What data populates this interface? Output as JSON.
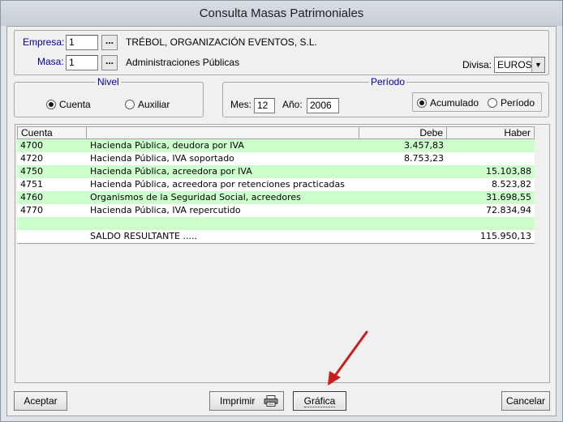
{
  "window": {
    "title": "Consulta Masas Patrimoniales"
  },
  "header": {
    "empresa_label": "Empresa:",
    "empresa_value": "1",
    "empresa_name": "TRÉBOL, ORGANIZACIÓN EVENTOS, S.L.",
    "masa_label": "Masa:",
    "masa_value": "1",
    "masa_name": "Administraciones Públicas",
    "lookup_label": "...",
    "divisa_label": "Divisa:",
    "divisa_value": "EUROS"
  },
  "nivel": {
    "title": "Nivel",
    "options": [
      {
        "label": "Cuenta",
        "selected": true
      },
      {
        "label": "Auxiliar",
        "selected": false
      }
    ]
  },
  "periodo": {
    "title": "Período",
    "mes_label": "Mes:",
    "mes_value": "12",
    "anio_label": "Año:",
    "anio_value": "2006",
    "options": [
      {
        "label": "Acumulado",
        "selected": true
      },
      {
        "label": "Período",
        "selected": false
      }
    ]
  },
  "table": {
    "columns": [
      "Cuenta",
      "",
      "Debe",
      "Haber"
    ],
    "rows": [
      {
        "cuenta": "4700",
        "descripcion": "Hacienda Pública, deudora por IVA",
        "debe": "3.457,83",
        "haber": ""
      },
      {
        "cuenta": "4720",
        "descripcion": "Hacienda Pública, IVA soportado",
        "debe": "8.753,23",
        "haber": ""
      },
      {
        "cuenta": "4750",
        "descripcion": "Hacienda Pública, acreedora por IVA",
        "debe": "",
        "haber": "15.103,88"
      },
      {
        "cuenta": "4751",
        "descripcion": "Hacienda Pública, acreedora por retenciones practicadas",
        "debe": "",
        "haber": "8.523,82"
      },
      {
        "cuenta": "4760",
        "descripcion": "Organismos de la Seguridad Social, acreedores",
        "debe": "",
        "haber": "31.698,55"
      },
      {
        "cuenta": "4770",
        "descripcion": "Hacienda Pública, IVA repercutido",
        "debe": "",
        "haber": "72.834,94"
      },
      {
        "cuenta": "",
        "descripcion": "",
        "debe": "",
        "haber": ""
      },
      {
        "cuenta": "",
        "descripcion": "SALDO RESULTANTE .....",
        "debe": "",
        "haber": "115.950,13"
      }
    ]
  },
  "buttons": {
    "aceptar": "Aceptar",
    "imprimir": "Imprimir",
    "grafica": "Gráfica",
    "cancelar": "Cancelar"
  },
  "colors": {
    "row_green": "#ccffcc",
    "label_blue": "#0000a8",
    "arrow_red": "#c81e1e"
  }
}
